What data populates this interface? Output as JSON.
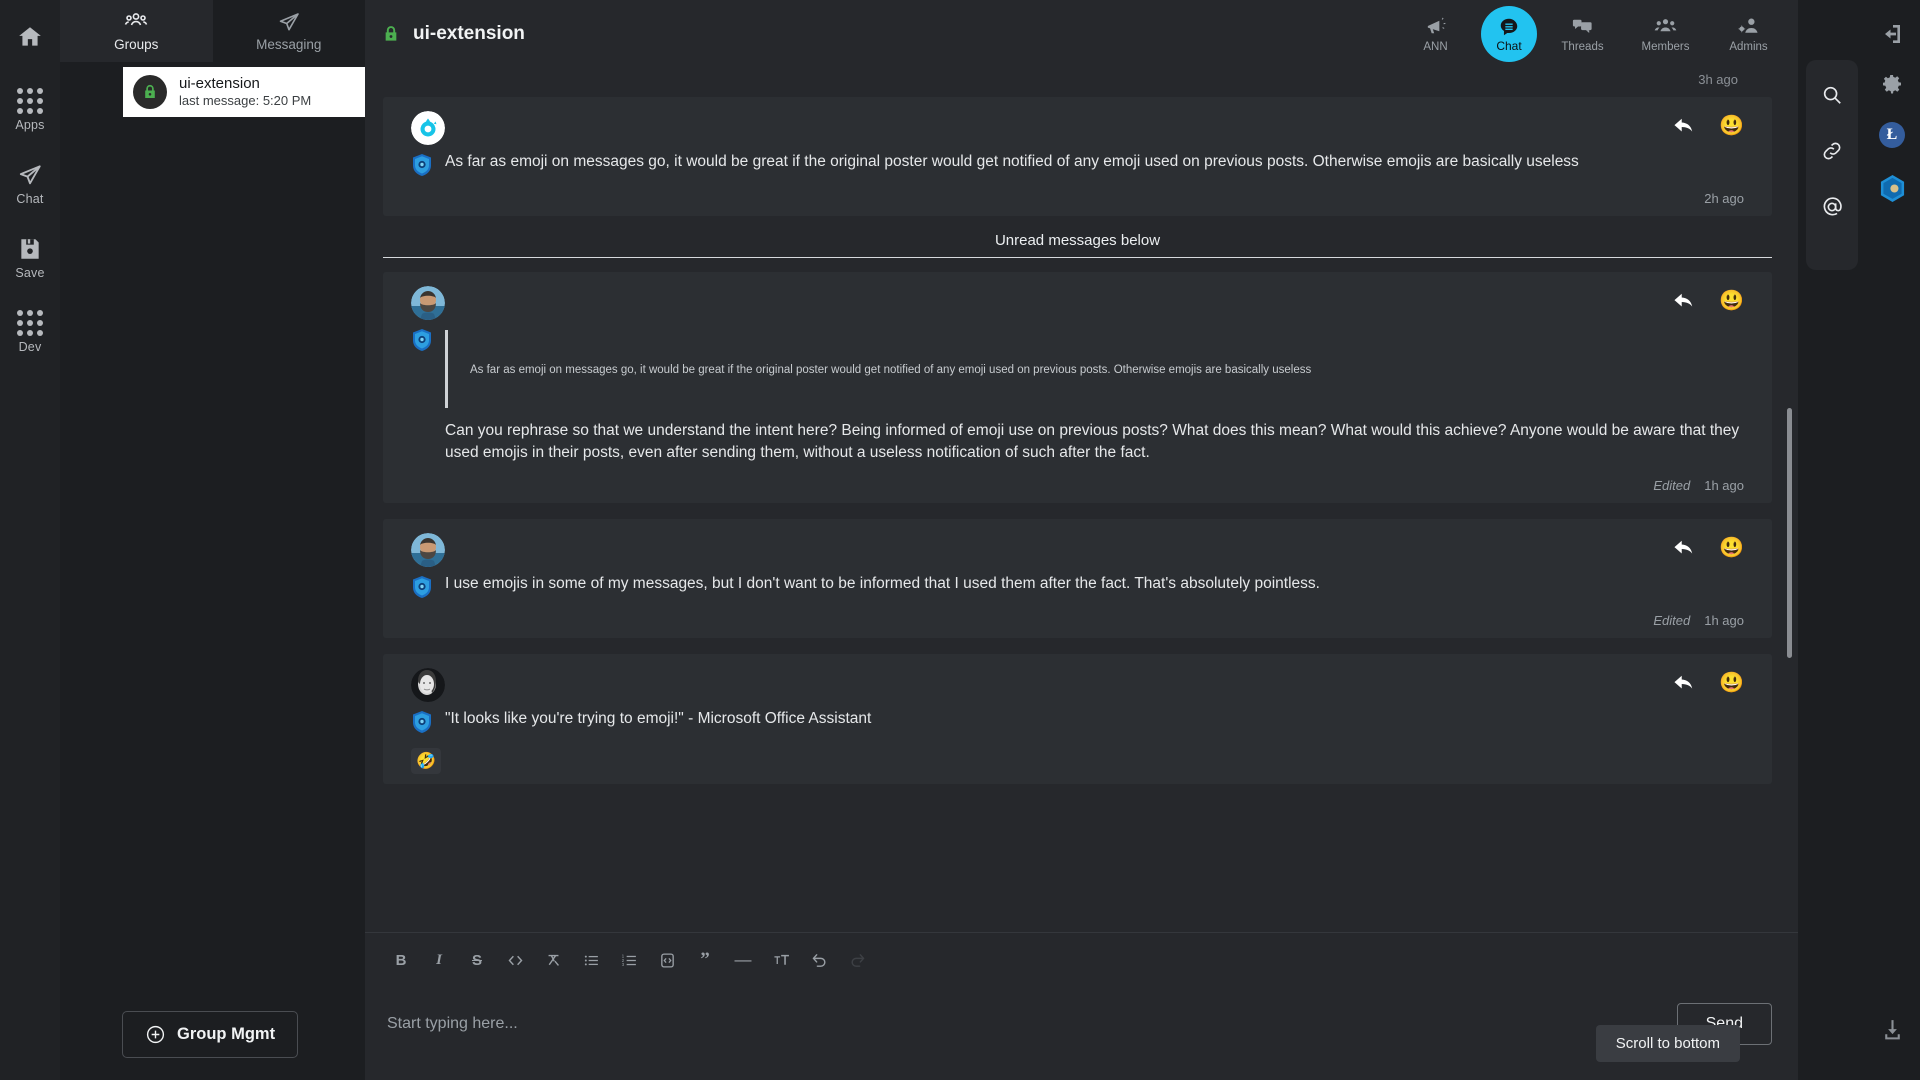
{
  "rail": {
    "items": [
      {
        "icon": "home-icon",
        "label": ""
      },
      {
        "icon": "apps-grid-icon",
        "label": "Apps"
      },
      {
        "icon": "chat-send-icon",
        "label": "Chat"
      },
      {
        "icon": "save-disk-icon",
        "label": "Save"
      },
      {
        "icon": "dev-grid-icon",
        "label": "Dev"
      }
    ]
  },
  "groups_panel": {
    "tabs": [
      {
        "label": "Groups",
        "icon": "people-group-icon",
        "active": true
      },
      {
        "label": "Messaging",
        "icon": "paper-plane-icon",
        "active": false
      }
    ],
    "conversations": [
      {
        "name": "ui-extension",
        "subtitle": "last message: 5:20 PM",
        "icon": "lock-icon",
        "selected": true
      }
    ],
    "group_mgmt_label": "Group Mgmt",
    "group_mgmt_icon": "plus-circle-icon"
  },
  "header": {
    "lock_icon": "lock-icon",
    "title": "ui-extension",
    "tabs": [
      {
        "label": "ANN",
        "icon": "megaphone-icon",
        "active": false
      },
      {
        "label": "Chat",
        "icon": "chat-lines-icon",
        "active": true
      },
      {
        "label": "Threads",
        "icon": "threads-icon",
        "active": false
      },
      {
        "label": "Members",
        "icon": "members-icon",
        "active": false
      },
      {
        "label": "Admins",
        "icon": "admin-gear-user-icon",
        "active": false
      }
    ]
  },
  "messages": {
    "top_time": "3h ago",
    "unread_divider": "Unread messages below",
    "scroll_to_bottom": "Scroll to bottom",
    "items": [
      {
        "avatar": "teal-logo-avatar",
        "badge": "blue-shield-badge",
        "text": "As far as emoji on messages go, it would be great if the original poster would get notified of any emoji used on previous posts. Otherwise emojis are basically useless",
        "edited": "",
        "time": "2h ago",
        "quote": "",
        "reaction": ""
      },
      {
        "avatar": "bearded-man-avatar",
        "badge": "blue-shield-badge",
        "quote": "As far as emoji on messages go, it would be great if the original poster would get notified of any emoji used on previous posts. Otherwise emojis are basically useless",
        "text": "Can you rephrase so that we understand the intent here? Being informed of emoji use on previous posts? What does this mean? What would this achieve? Anyone would be aware that they used emojis in their posts, even after sending them, without a useless notification of such after the fact.",
        "edited": "Edited",
        "time": "1h ago",
        "reaction": ""
      },
      {
        "avatar": "bearded-man-avatar",
        "badge": "blue-shield-badge",
        "quote": "",
        "text": "I use emojis in some of my messages, but I don't want to be informed that I used them after the fact. That's absolutely pointless.",
        "edited": "Edited",
        "time": "1h ago",
        "reaction": ""
      },
      {
        "avatar": "grayscale-portrait-avatar",
        "badge": "blue-shield-badge",
        "quote": "",
        "text": "\"It looks like you're trying to emoji!\" - Microsoft Office Assistant",
        "edited": "",
        "time": "",
        "reaction": "🤣"
      }
    ],
    "reply_icon": "reply-arrow-icon",
    "react_emoji": "😃"
  },
  "composer": {
    "format_buttons": [
      {
        "name": "bold-button",
        "glyph": "B"
      },
      {
        "name": "italic-button",
        "glyph": "I"
      },
      {
        "name": "strikethrough-button",
        "glyph": "S"
      },
      {
        "name": "inline-code-button",
        "glyph": "<>"
      },
      {
        "name": "clear-formatting-button",
        "glyph": "X"
      },
      {
        "name": "bullet-list-button",
        "glyph": "list"
      },
      {
        "name": "numbered-list-button",
        "glyph": "numlist"
      },
      {
        "name": "code-block-button",
        "glyph": "codeblock"
      },
      {
        "name": "blockquote-button",
        "glyph": "”"
      },
      {
        "name": "horizontal-rule-button",
        "glyph": "—"
      },
      {
        "name": "text-size-button",
        "glyph": "TT"
      },
      {
        "name": "undo-button",
        "glyph": "undo"
      },
      {
        "name": "redo-button",
        "glyph": "redo"
      }
    ],
    "input_placeholder": "Start typing here...",
    "input_value": "",
    "send_label": "Send"
  },
  "right_panel": {
    "icons": [
      {
        "name": "search-icon"
      },
      {
        "name": "link-icon"
      },
      {
        "name": "mention-icon"
      }
    ]
  },
  "edge_rail": {
    "icons": [
      {
        "name": "logout-icon"
      },
      {
        "name": "settings-gear-icon"
      },
      {
        "name": "litecoin-badge-icon",
        "glyph": "Ł"
      },
      {
        "name": "hexagon-app-icon"
      }
    ],
    "download_icon": "download-icon"
  },
  "colors": {
    "accent": "#22c3f0",
    "lock_green": "#4caf50",
    "panel_bg": "#1c1e21",
    "chat_bg": "#26282c",
    "message_bg": "#2c2f33"
  }
}
